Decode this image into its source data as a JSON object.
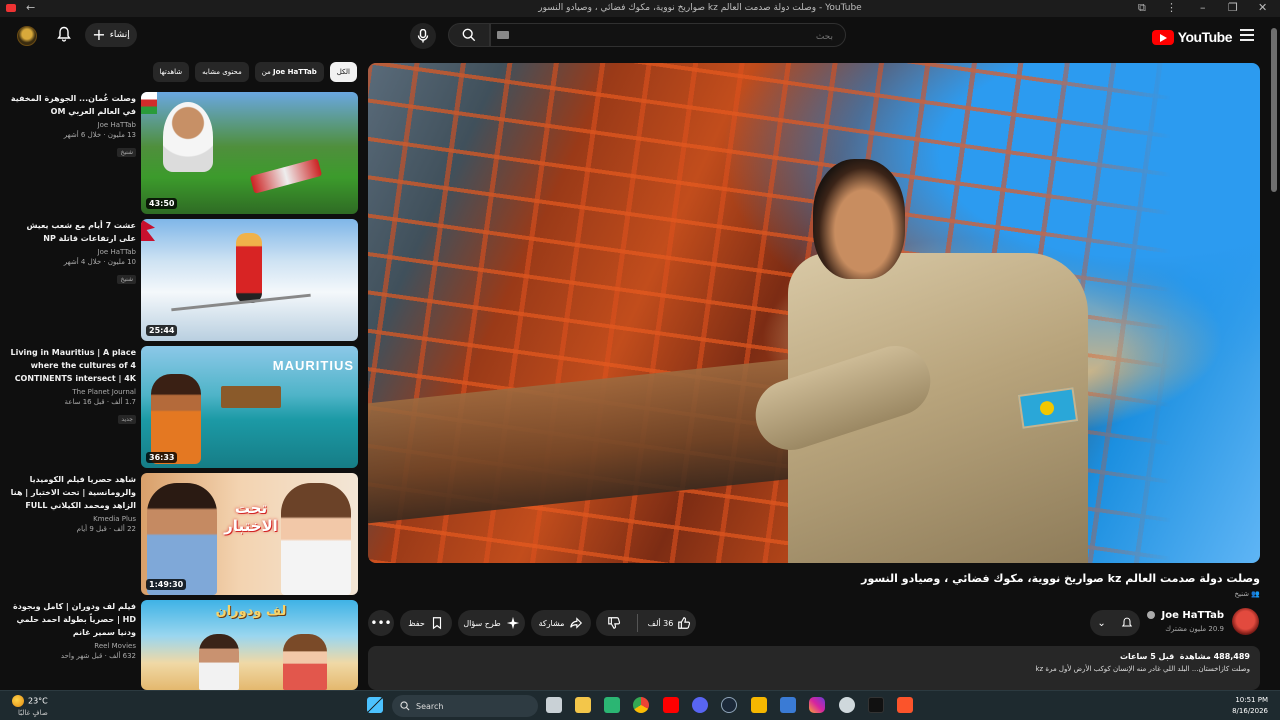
{
  "browser": {
    "window_title": "صواريخ نووية، مكوك فضائي ، وصيادو النسور kz وصلت دولة صدمت العالم - YouTube"
  },
  "header": {
    "logo_text": "YouTube",
    "search_placeholder": "بحث",
    "create_label": "إنشاء"
  },
  "chips": [
    {
      "label": "الكل"
    },
    {
      "label": "من",
      "bold": "Joe HaTTab"
    },
    {
      "label": "محتوى مشابه"
    },
    {
      "label": "شاهدتها"
    }
  ],
  "video": {
    "title": "وصلت دولة صدمت العالم kz صواريخ نووية، مكوك فضائي ، وصيادو النسور",
    "badge": "شنيخ",
    "channel": "Joe HaTTab",
    "subscribers": "20.9 مليون مشترك",
    "likes": "36 ألف",
    "share_label": "مشاركة",
    "ask_label": "طرح سؤال",
    "save_label": "حفظ",
    "views": "488,489 مشاهدة",
    "time": "قبل 5 ساعات",
    "description": "وصلت كازاخستان... البلد اللي غادر منه الإنسان كوكب الأرض لأول مرة kz"
  },
  "sidebar": {
    "items": [
      {
        "title": "وصلت عُمان... الجوهرة المخفية في العالم العربي OM",
        "channel": "Joe HaTTab",
        "views": "13 مليون",
        "time": "خلال 6 أشهر",
        "badge": "شنيخ",
        "duration": "43:50"
      },
      {
        "title": "عشت 7 أيام مع شعب يعيش على ارتفاعات قاتلة NP",
        "channel": "Joe HaTTab",
        "views": "10 مليون",
        "time": "خلال 4 أشهر",
        "badge": "شنيخ",
        "duration": "25:44"
      },
      {
        "title": "Living in Mauritius | A place where the cultures of 4 CONTINENTS intersect | 4K ...",
        "channel": "The Planet Journal",
        "views": "1.7 ألف",
        "time": "قبل 16 ساعة",
        "badge": "جديد",
        "duration": "36:33",
        "thumb_text": "MAURITIUS"
      },
      {
        "title": "شاهد حصريا فيلم الكوميديا والرومانسية | تحت الاختبار | هنا الزاهد ومحمد الكيلاني FULL HD",
        "channel": "Kmedia Plus",
        "views": "22 ألف",
        "time": "قبل 9 أيام",
        "duration": "1:49:30",
        "thumb_text": "تحت الاختبار"
      },
      {
        "title": "فيلم لف ودوران | كامل وبجودة HD | حصرياً بطولة احمد حلمي ودنيا سمير غانم",
        "channel": "Reel Movies",
        "views": "632 ألف",
        "time": "قبل شهر واحد",
        "thumb_text": "لف ودوران"
      }
    ]
  },
  "taskbar": {
    "temperature": "23°C",
    "weather": "صافٍ غالبًا",
    "search_label": "Search",
    "time": "10:51 PM",
    "date": "8/16/2026"
  },
  "colors": {
    "background": "#0f0f0f",
    "surface": "#272727",
    "brand_red": "#ff0000"
  }
}
